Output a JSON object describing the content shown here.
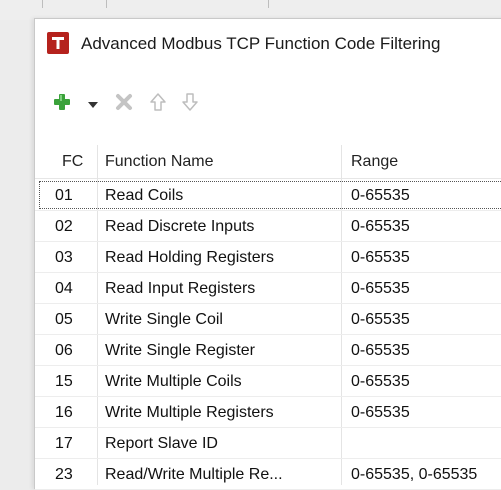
{
  "window": {
    "title": "Advanced Modbus TCP Function Code Filtering"
  },
  "toolbar": {
    "add_icon": "plus-icon",
    "dropdown_icon": "caret-down-icon",
    "delete_icon": "delete-x-icon",
    "move_up_icon": "arrow-up-icon",
    "move_down_icon": "arrow-down-icon"
  },
  "colors": {
    "app_icon": "#b5221d",
    "add_green": "#3aa23a",
    "disabled_gray": "#c4c4c4"
  },
  "table": {
    "headers": {
      "fc": "FC",
      "function_name": "Function Name",
      "range": "Range"
    },
    "rows": [
      {
        "fc": "01",
        "name": "Read Coils",
        "range": "0-65535"
      },
      {
        "fc": "02",
        "name": "Read Discrete Inputs",
        "range": "0-65535"
      },
      {
        "fc": "03",
        "name": "Read Holding Registers",
        "range": "0-65535"
      },
      {
        "fc": "04",
        "name": "Read Input Registers",
        "range": "0-65535"
      },
      {
        "fc": "05",
        "name": "Write Single Coil",
        "range": "0-65535"
      },
      {
        "fc": "06",
        "name": "Write Single Register",
        "range": "0-65535"
      },
      {
        "fc": "15",
        "name": "Write Multiple Coils",
        "range": "0-65535"
      },
      {
        "fc": "16",
        "name": "Write Multiple Registers",
        "range": "0-65535"
      },
      {
        "fc": "17",
        "name": "Report Slave ID",
        "range": ""
      },
      {
        "fc": "23",
        "name": "Read/Write Multiple Re...",
        "range": "0-65535, 0-65535"
      }
    ],
    "selected_row": 0
  }
}
